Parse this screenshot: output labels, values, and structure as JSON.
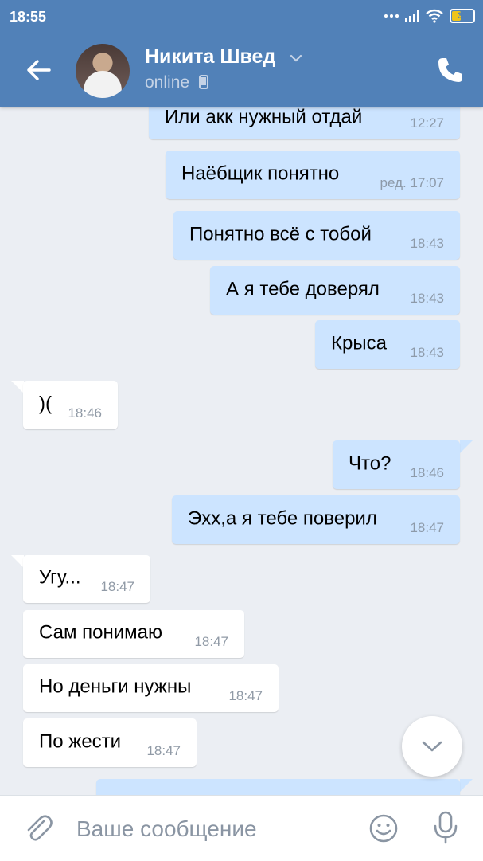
{
  "status_bar": {
    "time": "18:55",
    "battery": "39"
  },
  "header": {
    "contact_name": "Никита Швед",
    "status": "online"
  },
  "messages": [
    {
      "dir": "out",
      "text": "Или акк нужный отдай",
      "time": "12:27"
    },
    {
      "dir": "out",
      "text": "Наёбщик понятно",
      "time": "ред. 17:07"
    },
    {
      "dir": "out",
      "text": "Понятно всё с тобой",
      "time": "18:43"
    },
    {
      "dir": "out",
      "text": "А я тебе доверял",
      "time": "18:43"
    },
    {
      "dir": "out",
      "text": "Крыса",
      "time": "18:43"
    },
    {
      "dir": "in",
      "text": ")(",
      "time": "18:46"
    },
    {
      "dir": "out",
      "text": "Что?",
      "time": "18:46"
    },
    {
      "dir": "out",
      "text": "Эхх,а я тебе поверил",
      "time": "18:47"
    },
    {
      "dir": "in",
      "text": "Угу...",
      "time": "18:47"
    },
    {
      "dir": "in",
      "text": "Сам понимаю",
      "time": "18:47"
    },
    {
      "dir": "in",
      "text": "Но деньги нужны",
      "time": "18:47"
    },
    {
      "dir": "in",
      "text": "По жести",
      "time": "18:47"
    }
  ],
  "composer": {
    "placeholder": "Ваше сообщение"
  },
  "colors": {
    "header": "#5181b8",
    "outgoing_bubble": "#cce4ff",
    "incoming_bubble": "#ffffff",
    "background": "#ebeef3"
  },
  "icons": [
    "back-arrow-icon",
    "chevron-down-icon",
    "mobile-device-icon",
    "phone-icon",
    "chevron-down-icon",
    "paperclip-icon",
    "smile-icon",
    "microphone-icon"
  ]
}
